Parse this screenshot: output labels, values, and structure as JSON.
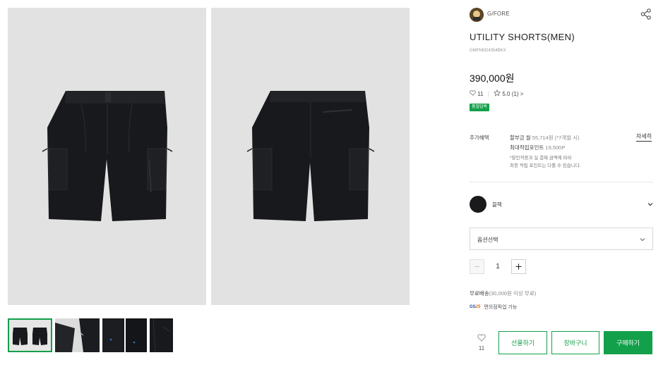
{
  "gallery": {
    "main_images": [
      {
        "name": "front-view",
        "alt": "front"
      },
      {
        "name": "back-view",
        "alt": "back"
      }
    ],
    "thumbnails": [
      {
        "selected": true
      },
      {
        "selected": false
      },
      {
        "selected": false
      },
      {
        "selected": false
      }
    ]
  },
  "product": {
    "brand": "G/FORE",
    "title": "UTILITY SHORTS(MEN)",
    "code": "GMPNM24354BKX",
    "price": "390,000원",
    "likes": "11",
    "rating": "5.0",
    "reviews": "(1)",
    "review_chevron": ">",
    "badge": "품절임박"
  },
  "benefits": {
    "label": "추가혜택",
    "installment_prefix": "할부금 월",
    "installment_detail": "55,714원 (*7개월 시)",
    "points_prefix": "최대적립포인트",
    "points_value": "19,500P",
    "note_line1": "*할인적용과 실 결제 금액에 따라",
    "note_line2": "최종 적립 포인트는 다를 수 있습니다.",
    "detail_link": "자세히"
  },
  "options": {
    "color_name": "블랙",
    "color_hex": "#1a1a1c",
    "option_placeholder": "옵션선택",
    "quantity": "1"
  },
  "delivery": {
    "free_label": "무료배송",
    "free_detail": "(30,000원 이상 무료)",
    "gs_logo_prefix": "GS",
    "gs_logo_num": "25",
    "gs_text": "편의점픽업 가능"
  },
  "actions": {
    "like_count": "11",
    "gift": "선물하기",
    "cart": "장바구니",
    "buy": "구매하기"
  },
  "colors": {
    "accent": "#13a04a",
    "photo_bg": "#e2e2e2"
  }
}
